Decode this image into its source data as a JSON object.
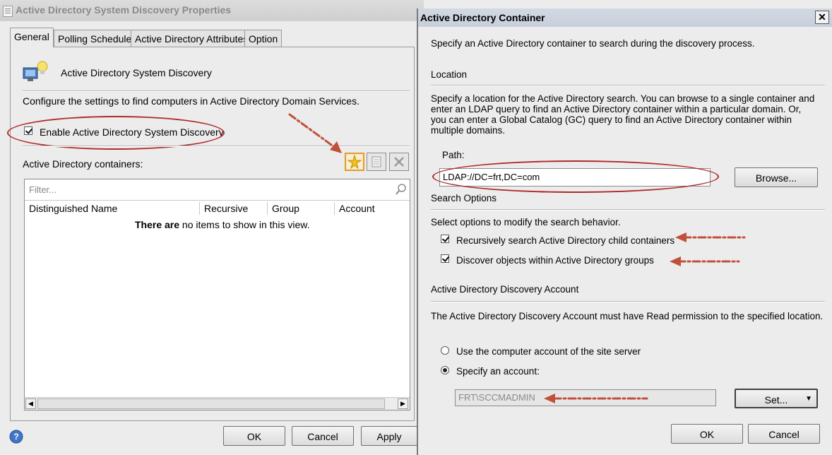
{
  "properties_window": {
    "title": "Active Directory System Discovery Properties",
    "tabs": [
      {
        "label": "General",
        "active": true
      },
      {
        "label": "Polling Schedule",
        "active": false
      },
      {
        "label": "Active Directory Attributes",
        "active": false
      },
      {
        "label": "Option",
        "active": false
      }
    ],
    "method_name": "Active Directory System Discovery",
    "description": "Configure the settings to find computers in Active Directory Domain Services.",
    "enable_checkbox": {
      "label": "Enable Active Directory System Discovery",
      "checked": true
    },
    "containers_label": "Active Directory containers:",
    "toolbar": {
      "icons": [
        "new-icon",
        "properties-icon",
        "delete-icon"
      ]
    },
    "filter_placeholder": "Filter...",
    "columns": [
      "Distinguished Name",
      "Recursive",
      "Group",
      "Account"
    ],
    "empty_prefix": "There are",
    "empty_rest": " no items to show in this view.",
    "buttons": {
      "ok": "OK",
      "cancel": "Cancel",
      "apply": "Apply"
    }
  },
  "container_dialog": {
    "title": "Active Directory Container",
    "intro": "Specify an Active Directory container to search during the discovery process.",
    "location_heading": "Location",
    "location_description": "Specify a location for the Active Directory search. You can browse to a single container and enter an LDAP query to find an Active Directory container within a particular domain. Or, you can enter a Global Catalog (GC) query to find an Active Directory container within multiple domains.",
    "path_label": "Path:",
    "path_value": "LDAP://DC=frt,DC=com",
    "browse_button": "Browse...",
    "search_options_heading": "Search Options",
    "search_options_description": "Select options to modify the search behavior.",
    "recursive_checkbox": {
      "label": "Recursively search Active Directory child containers",
      "checked": true
    },
    "groups_checkbox": {
      "label": "Discover objects within Active Directory groups",
      "checked": true
    },
    "account_heading": "Active Directory Discovery Account",
    "account_description": "The Active Directory Discovery Account must have Read permission to the specified location.",
    "radio_computer": {
      "label": "Use the computer account of the site server",
      "selected": false
    },
    "radio_specify": {
      "label": "Specify an account:",
      "selected": true
    },
    "account_value": "FRT\\SCCMADMIN",
    "set_button": "Set...",
    "ok_button": "OK",
    "cancel_button": "Cancel"
  },
  "colors": {
    "annotation_red": "#b02a2a",
    "arrow_red": "#c0503a"
  }
}
